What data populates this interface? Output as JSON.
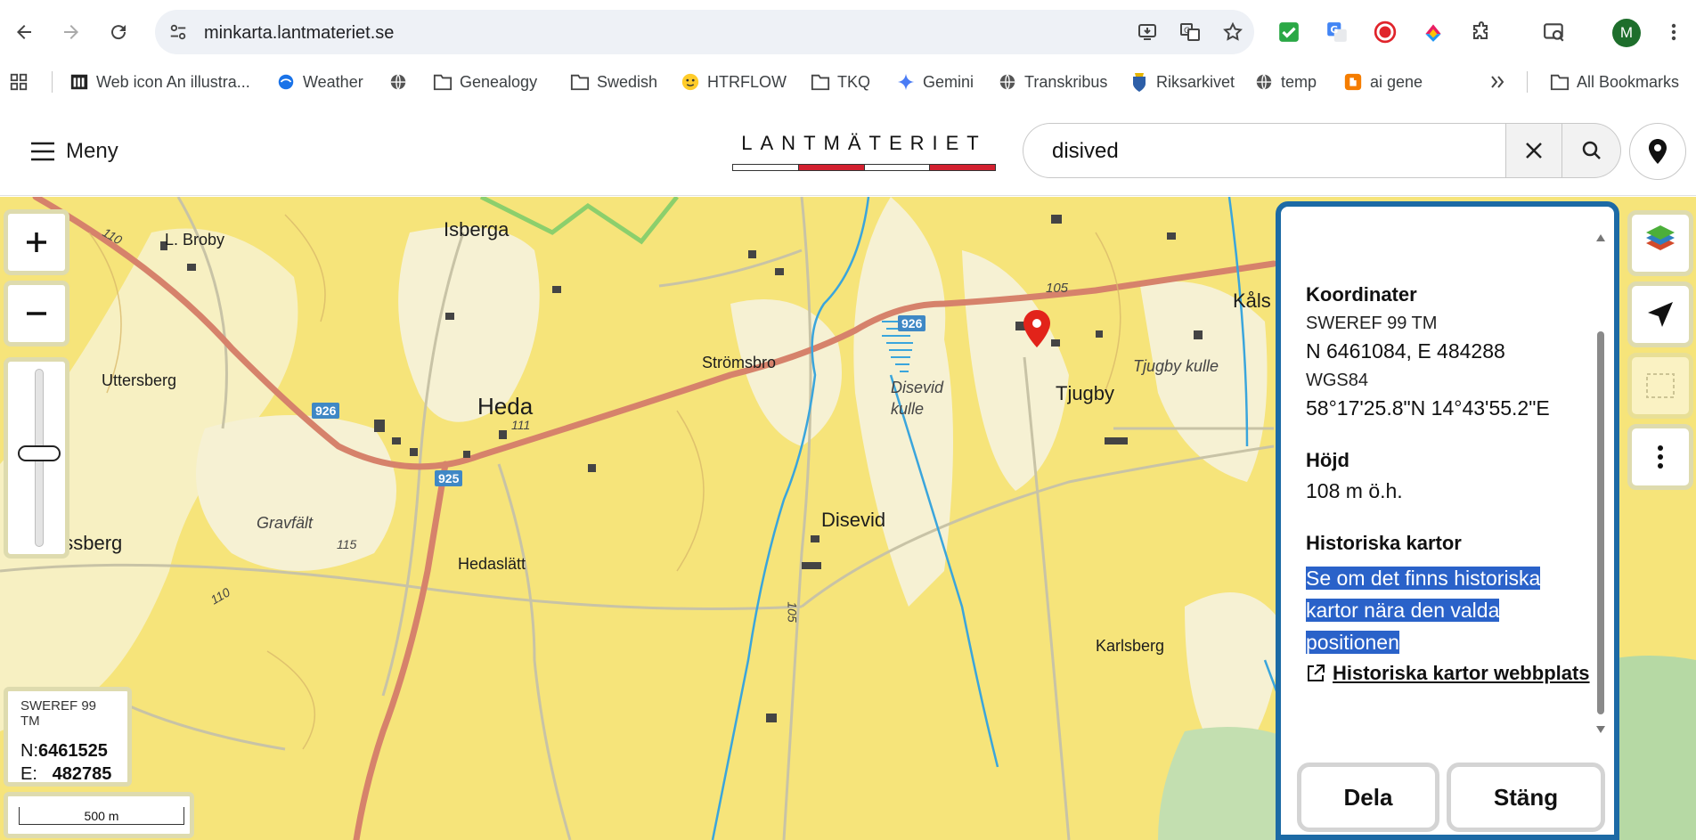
{
  "browser": {
    "url": "minkarta.lantmateriet.se",
    "profile_initial": "M",
    "bookmarks": [
      {
        "label": "Web icon An illustra...",
        "icon": "bookmark-page-icon"
      },
      {
        "label": "Weather",
        "icon": "weather-icon"
      },
      {
        "label": "",
        "icon": "globe-icon"
      },
      {
        "label": "Genealogy",
        "icon": "folder-icon"
      },
      {
        "label": "Swedish",
        "icon": "folder-icon"
      },
      {
        "label": "HTRFLOW",
        "icon": "hugging-face-icon"
      },
      {
        "label": "TKQ",
        "icon": "folder-icon"
      },
      {
        "label": "Gemini",
        "icon": "gemini-icon"
      },
      {
        "label": "Transkribus",
        "icon": "globe-icon"
      },
      {
        "label": "Riksarkivet",
        "icon": "crest-icon"
      },
      {
        "label": "temp",
        "icon": "globe-icon"
      },
      {
        "label": "ai gene",
        "icon": "blogger-icon"
      }
    ],
    "all_bookmarks_label": "All Bookmarks"
  },
  "header": {
    "menu_label": "Meny",
    "logo_text": "LANTMÄTERIET",
    "search_value": "disived",
    "colors": {
      "accent": "#1c6aa5",
      "logo_red": "#d3202f"
    }
  },
  "map": {
    "places": [
      {
        "name": "L. Broby"
      },
      {
        "name": "Isberga"
      },
      {
        "name": "Uttersberg"
      },
      {
        "name": "Heda"
      },
      {
        "name": "Strömsbro"
      },
      {
        "name": "Disevid kulle"
      },
      {
        "name": "Tjugby"
      },
      {
        "name": "Tjugby kulle"
      },
      {
        "name": "Kåls"
      },
      {
        "name": "Disevid"
      },
      {
        "name": "Gravfält"
      },
      {
        "name": "Jussberg"
      },
      {
        "name": "Hedaslätt"
      },
      {
        "name": "Karlsberg"
      }
    ],
    "road_numbers": [
      "926",
      "926",
      "925"
    ],
    "contour_labels": [
      "110",
      "105",
      "111",
      "115",
      "110",
      "105"
    ],
    "coordinates": {
      "system": "SWEREF 99 TM",
      "n_label": "N:",
      "n_value": "6461525",
      "e_label": "E:",
      "e_value": "482785"
    },
    "scale_label": "500 m"
  },
  "panel": {
    "koordinater_heading": "Koordinater",
    "sweref_label": "SWEREF 99 TM",
    "sweref_value": "N 6461084, E 484288",
    "wgs_label": "WGS84",
    "wgs_value": "58°17'25.8\"N 14°43'55.2\"E",
    "hojd_heading": "Höjd",
    "hojd_value": "108 m ö.h.",
    "historiska_heading": "Historiska kartor",
    "historiska_text_1": "Se om det finns historiska",
    "historiska_text_2": "kartor nära den valda",
    "historiska_text_3": "positionen",
    "historiska_link": "Historiska kartor webbplats",
    "share_label": "Dela",
    "close_label": "Stäng"
  }
}
